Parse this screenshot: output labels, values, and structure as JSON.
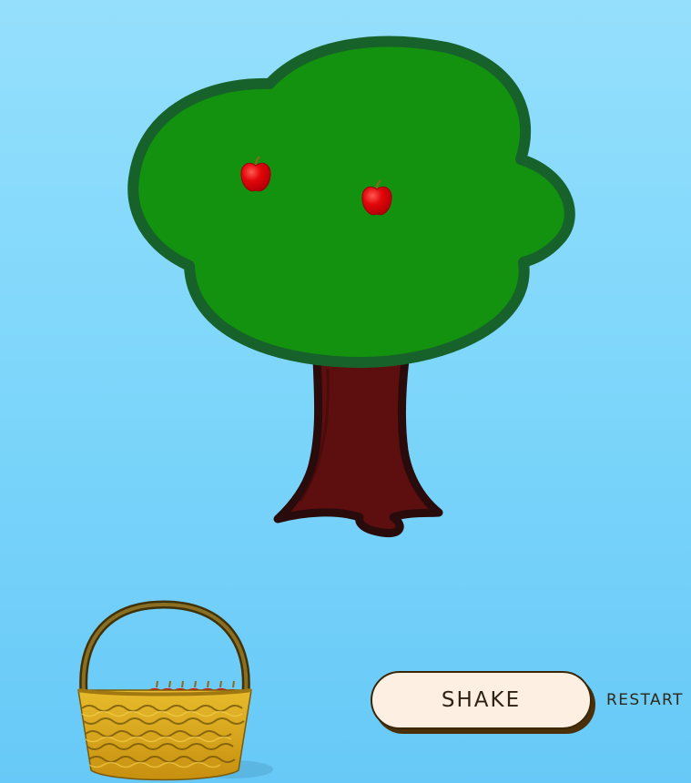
{
  "game": {
    "apples_on_tree": 2,
    "apples_in_basket": 6
  },
  "controls": {
    "shake_label": "SHAKE",
    "restart_label": "RESTART"
  },
  "colors": {
    "sky_top": "#95dffc",
    "sky_bottom": "#67c9f7",
    "foliage": "#13920f",
    "foliage_outline": "#17622a",
    "trunk": "#5c0f0e",
    "trunk_outline": "#2a0b0b",
    "apple": "#e3070b",
    "basket": "#d8aa1a",
    "basket_handle": "#6b5619",
    "button_bg": "#fdf0e3",
    "button_shadow": "#4a300a"
  }
}
